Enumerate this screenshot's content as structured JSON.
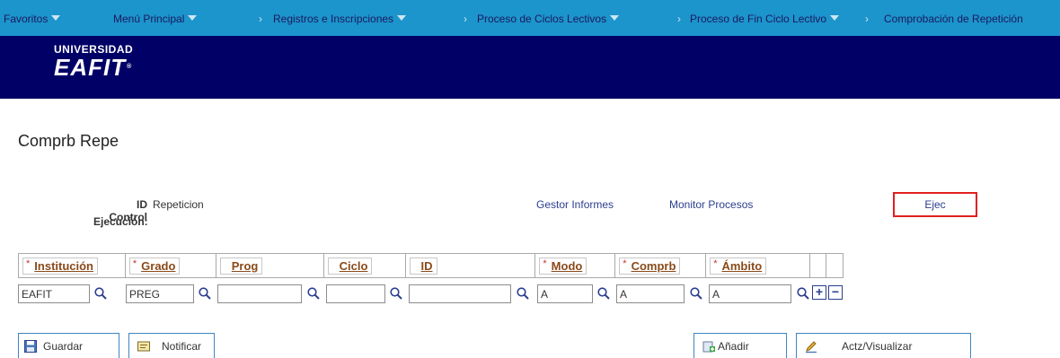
{
  "nav": {
    "favoritos": "Favoritos",
    "menu_principal": "Menú Principal",
    "sep": "›",
    "registros": "Registros e Inscripciones",
    "ciclos": "Proceso de Ciclos Lectivos",
    "fin_ciclo": "Proceso de Fin Ciclo Lectivo",
    "comprobacion": "Comprobación de Repetición"
  },
  "logo": {
    "top": "UNIVERSIDAD",
    "main": "EAFIT",
    "reg": "®"
  },
  "page": {
    "title": "Comprb Repe"
  },
  "run_control": {
    "label_line1": "ID Control",
    "label_line2": "Ejecución:",
    "value": "Repeticion",
    "report_manager": "Gestor Informes",
    "process_monitor": "Monitor Procesos",
    "run_button": "Ejec"
  },
  "grid": {
    "columns": [
      {
        "label": "Institución",
        "required": true
      },
      {
        "label": "Grado",
        "required": true
      },
      {
        "label": "Prog",
        "required": false
      },
      {
        "label": "Ciclo",
        "required": false
      },
      {
        "label": "ID",
        "required": false
      },
      {
        "label": "Modo",
        "required": true
      },
      {
        "label": "Comprb",
        "required": true
      },
      {
        "label": "Ámbito",
        "required": true
      }
    ],
    "required_mark": "*",
    "row": [
      "EAFIT",
      "PREG",
      "",
      "",
      "",
      "A",
      "A",
      "A"
    ],
    "add_row": "+",
    "delete_row": "−"
  },
  "toolbar": {
    "save": "Guardar",
    "notify": "Notificar",
    "add": "Añadir",
    "update_display": "Actz/Visualizar"
  },
  "colors": {
    "nav_bg": "#1c94cc",
    "banner_bg": "#000066",
    "link": "#2b3e8f",
    "highlight": "#e0201f",
    "header_link": "#8a4a1a"
  }
}
